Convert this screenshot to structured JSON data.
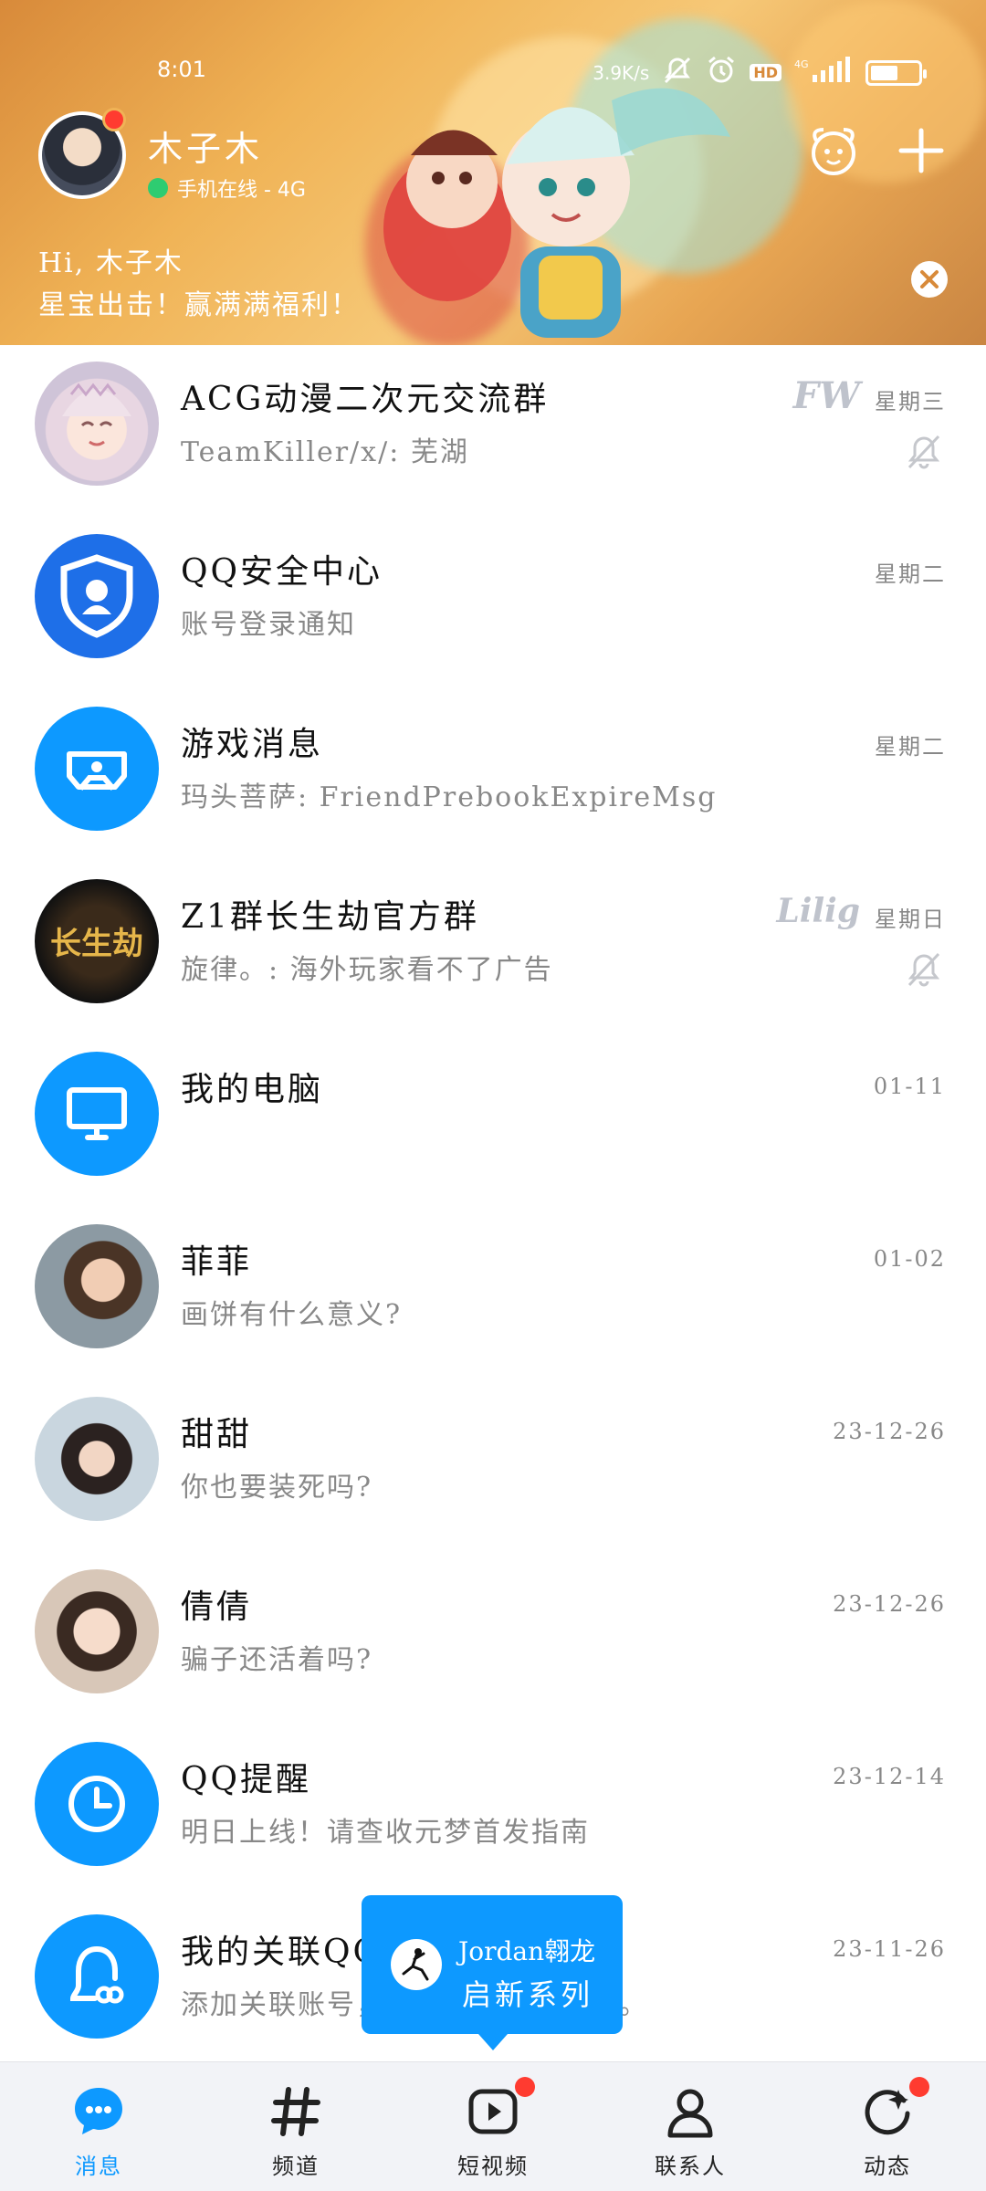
{
  "status_bar": {
    "time": "8:01",
    "net_speed": "3.9K/s",
    "hd": "HD",
    "signal": "4G",
    "battery": "51"
  },
  "header": {
    "user_name": "木子木",
    "online_status": "手机在线 - 4G",
    "promo_line1": "Hi, 木子木",
    "promo_line2": "星宝出击！赢满满福利！"
  },
  "chats": [
    {
      "title": "ACG动漫二次元交流群",
      "preview": "TeamKiller/x/: 芜湖",
      "time": "星期三",
      "tag": "FW",
      "muted": true
    },
    {
      "title": "QQ安全中心",
      "preview": "账号登录通知",
      "time": "星期二"
    },
    {
      "title": "游戏消息",
      "preview": "玛头菩萨: FriendPrebookExpireMsg",
      "time": "星期二"
    },
    {
      "title": "Z1群长生劫官方群",
      "preview": "旋律。: 海外玩家看不了广告",
      "time": "星期日",
      "tag": "Lilig",
      "muted": true
    },
    {
      "title": "我的电脑",
      "preview": "",
      "time": "01-11"
    },
    {
      "title": "菲菲",
      "preview": "画饼有什么意义?",
      "time": "01-02"
    },
    {
      "title": "甜甜",
      "preview": "你也要装死吗?",
      "time": "23-12-26"
    },
    {
      "title": "倩倩",
      "preview": "骗子还活着吗?",
      "time": "23-12-26"
    },
    {
      "title": "QQ提醒",
      "preview": "明日上线！请查收元梦首发指南",
      "time": "23-12-14"
    },
    {
      "title": "我的关联QQ",
      "preview": "添加关联账号，接收关联账号消息。",
      "time": "23-11-26"
    }
  ],
  "float_ad": {
    "line1": "Jordan翱龙",
    "line2": "启新系列"
  },
  "nav": [
    {
      "label": "消息",
      "active": true
    },
    {
      "label": "频道"
    },
    {
      "label": "短视频",
      "badge": true
    },
    {
      "label": "联系人"
    },
    {
      "label": "动态",
      "badge": true
    }
  ],
  "colors": {
    "accent": "#0d99ff",
    "badge": "#ff3b30",
    "online": "#2ecc71",
    "banner": "#f0b356"
  }
}
